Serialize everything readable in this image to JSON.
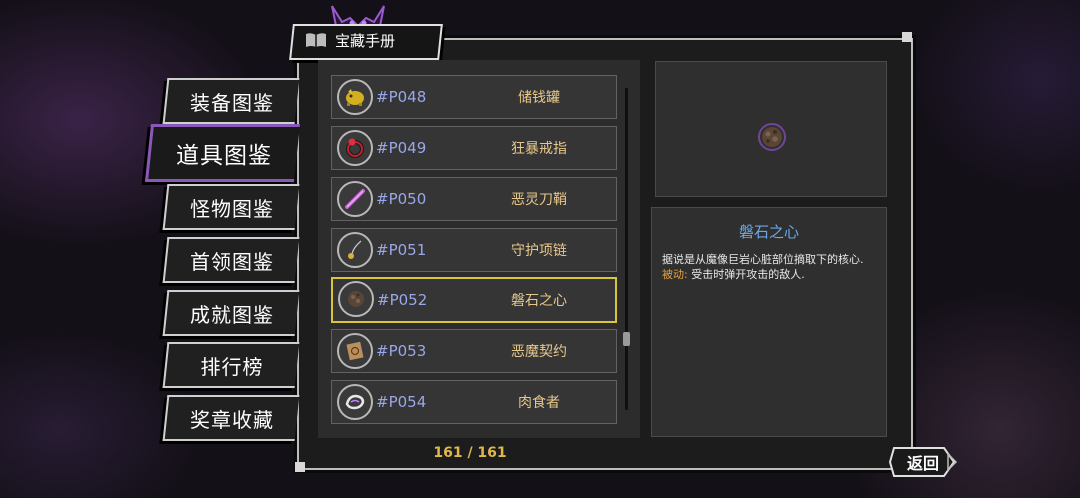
{
  "title_tab": {
    "label": "宝藏手册",
    "icon": "book-icon"
  },
  "nav": {
    "items": [
      {
        "label": "装备图鉴",
        "active": false
      },
      {
        "label": "道具图鉴",
        "active": true
      },
      {
        "label": "怪物图鉴",
        "active": false
      },
      {
        "label": "首领图鉴",
        "active": false
      },
      {
        "label": "成就图鉴",
        "active": false
      },
      {
        "label": "排行榜",
        "active": false
      },
      {
        "label": "奖章收藏",
        "active": false
      }
    ]
  },
  "items": [
    {
      "code": "#P048",
      "name": "储钱罐",
      "icon": "piggy-bank-icon",
      "selected": false
    },
    {
      "code": "#P049",
      "name": "狂暴戒指",
      "icon": "ring-icon",
      "selected": false
    },
    {
      "code": "#P050",
      "name": "恶灵刀鞘",
      "icon": "sheath-icon",
      "selected": false
    },
    {
      "code": "#P051",
      "name": "守护项链",
      "icon": "necklace-icon",
      "selected": false
    },
    {
      "code": "#P052",
      "name": "磐石之心",
      "icon": "rock-heart-icon",
      "selected": true
    },
    {
      "code": "#P053",
      "name": "恶魔契约",
      "icon": "contract-icon",
      "selected": false
    },
    {
      "code": "#P054",
      "name": "肉食者",
      "icon": "carnivore-icon",
      "selected": false
    }
  ],
  "counter": "161 / 161",
  "detail": {
    "name": "磐石之心",
    "desc_line1": "据说是从魔像巨岩心脏部位摘取下的核心.",
    "passive_label": "被动:",
    "passive_text": " 受击时弹开攻击的敌人."
  },
  "back_button": {
    "label": "返回"
  },
  "colors": {
    "accent_purple": "#8a58b8",
    "selected_border": "#d8c63a",
    "code_text": "#9aa7e8",
    "name_text": "#e8c88a",
    "detail_title": "#6aa8e6",
    "passive_keyword": "#e6a23c",
    "counter_text": "#e0b84a"
  }
}
